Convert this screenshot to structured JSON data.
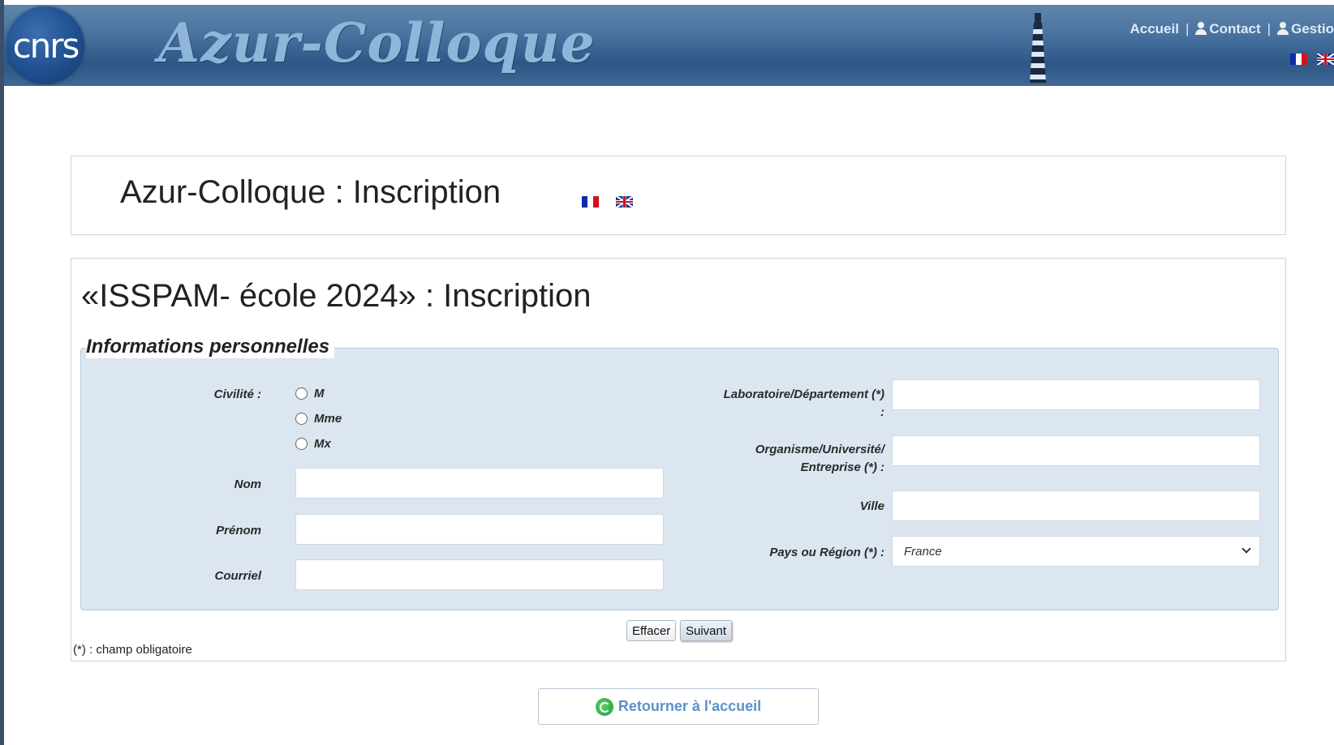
{
  "banner": {
    "logo_text": "cnrs",
    "brand_title": "Azur-Colloque",
    "nav": [
      {
        "label": "Accueil"
      },
      {
        "label": "Contact"
      },
      {
        "label": "Gestio"
      }
    ],
    "separator": "|"
  },
  "title_box": {
    "heading": "Azur-Colloque : Inscription"
  },
  "main": {
    "heading": "«ISSPAM- école 2024» : Inscription",
    "section_title": "Informations personnelles",
    "civilite": {
      "label": "Civilité :",
      "options": [
        {
          "label": "M"
        },
        {
          "label": "Mme"
        },
        {
          "label": "Mx"
        }
      ]
    },
    "left_fields": [
      {
        "label": "Nom",
        "value": ""
      },
      {
        "label": "Prénom",
        "value": ""
      },
      {
        "label": "Courriel",
        "value": ""
      }
    ],
    "right_fields": {
      "laboratoire": {
        "label_line1": "Laboratoire/Département (*)",
        "label_line2": ":",
        "value": ""
      },
      "organisme": {
        "label_line1": "Organisme/Université/",
        "label_line2": "Entreprise (*) :",
        "value": ""
      },
      "ville": {
        "label": "Ville",
        "value": ""
      },
      "pays": {
        "label": "Pays ou Région (*) :",
        "selected": "France"
      }
    },
    "buttons": {
      "clear": "Effacer",
      "next": "Suivant"
    },
    "required_note": "(*) : champ obligatoire"
  },
  "footer": {
    "return_label": "Retourner à l'accueil"
  },
  "colors": {
    "banner": "#2f5988",
    "fieldset_bg": "#dbe6f1",
    "link": "#5b92c8"
  }
}
